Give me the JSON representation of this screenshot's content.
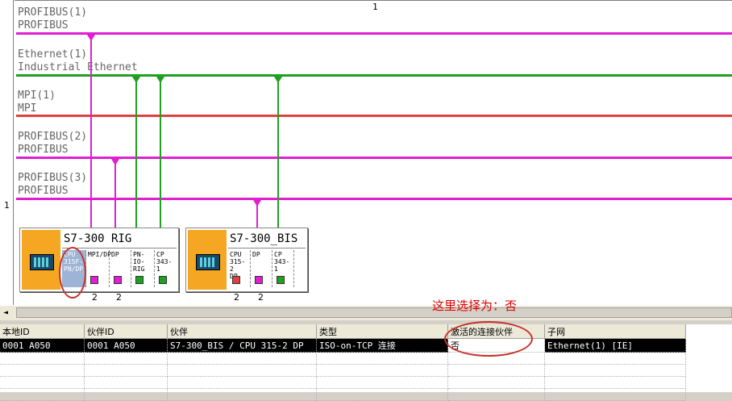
{
  "ruler": {
    "top_label": "1",
    "left_label": "1"
  },
  "networks": [
    {
      "name": "PROFIBUS(1)",
      "type": "PROFIBUS",
      "color": "#e020d0"
    },
    {
      "name": "Ethernet(1)",
      "type": "Industrial Ethernet",
      "color": "#20a020"
    },
    {
      "name": "MPI(1)",
      "type": "MPI",
      "color": "#e04040"
    },
    {
      "name": "PROFIBUS(2)",
      "type": "PROFIBUS",
      "color": "#e020d0"
    },
    {
      "name": "PROFIBUS(3)",
      "type": "PROFIBUS",
      "color": "#e020d0"
    }
  ],
  "stations": [
    {
      "title": "S7-300 RIG",
      "slots": [
        {
          "label": "CPU 315F-PN/DP",
          "lines": [
            "CPU",
            "315F-",
            "PN/DP"
          ],
          "port_color": null
        },
        {
          "label": "MPI/DP",
          "lines": [
            "MPI/DP"
          ],
          "port_color": "#e020d0"
        },
        {
          "label": "DP",
          "lines": [
            "DP"
          ],
          "port_color": "#e020d0"
        },
        {
          "label": "PN-IO-RIG",
          "lines": [
            "PN-",
            "IO-RIG"
          ],
          "port_color": "#20a020"
        },
        {
          "label": "CP 343-1",
          "lines": [
            "CP",
            "343-1"
          ],
          "port_color": "#20a020"
        }
      ],
      "port_numbers": [
        "2",
        "2"
      ]
    },
    {
      "title": "S7-300_BIS",
      "slots": [
        {
          "label": "CPU 315-2 DP",
          "lines": [
            "CPU",
            "315-2",
            "DP"
          ],
          "port_color": "#e04040"
        },
        {
          "label": "DP",
          "lines": [
            "DP"
          ],
          "port_color": "#e020d0"
        },
        {
          "label": "CP 343-1",
          "lines": [
            "CP",
            "343-1"
          ],
          "port_color": "#20a020"
        }
      ],
      "port_numbers": [
        "2",
        "2"
      ]
    }
  ],
  "annotation": "这里选择为：否",
  "connection_table": {
    "columns": [
      "本地ID",
      "伙伴ID",
      "伙伴",
      "类型",
      "激活的连接伙伴",
      "子网"
    ],
    "rows": [
      [
        "0001 A050",
        "0001 A050",
        "S7-300_BIS / CPU 315-2 DP",
        "ISO-on-TCP 连接",
        "否",
        "Ethernet(1) [IE]"
      ]
    ]
  }
}
